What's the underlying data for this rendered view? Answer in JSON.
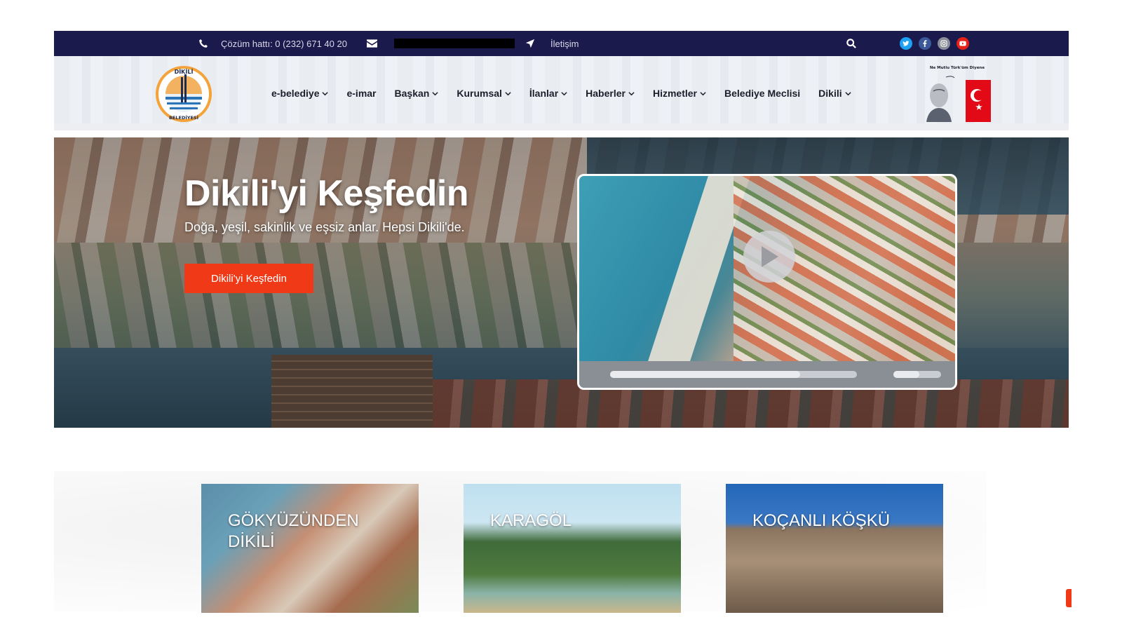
{
  "topbar": {
    "hotline": "Çözüm hattı: 0 (232) 671 40 20",
    "contact": "İletişim",
    "icons": [
      "phone-icon",
      "envelope-icon",
      "location-arrow-icon",
      "search-icon"
    ],
    "socials": [
      {
        "name": "twitter",
        "color": "#1da1f2"
      },
      {
        "name": "facebook",
        "color": "#3b5998"
      },
      {
        "name": "instagram",
        "color": "#8a8f99"
      },
      {
        "name": "youtube",
        "color": "#e62117"
      }
    ]
  },
  "header": {
    "logo_text": "DİKİLİ BELEDİYESİ",
    "nav": [
      {
        "label": "e-belediye",
        "dropdown": true
      },
      {
        "label": "e-imar",
        "dropdown": false
      },
      {
        "label": "Başkan",
        "dropdown": true
      },
      {
        "label": "Kurumsal",
        "dropdown": true
      },
      {
        "label": "İlanlar",
        "dropdown": true
      },
      {
        "label": "Haberler",
        "dropdown": true
      },
      {
        "label": "Hizmetler",
        "dropdown": true
      },
      {
        "label": "Belediye Meclisi",
        "dropdown": false
      },
      {
        "label": "Dikili",
        "dropdown": true
      }
    ],
    "ataturk_caption": "Ne Mutlu Türk'üm Diyene"
  },
  "hero": {
    "title": "Dikili'yi Keşfedin",
    "subtitle": "Doğa, yeşil, sakinlik ve eşsiz anlar. Hepsi Dikili'de.",
    "button": "Dikili'yi Keşfedin",
    "video_progress": 0.77,
    "video_volume": 0.55
  },
  "cards": [
    {
      "title": "GÖKYÜZÜNDEN DİKİLİ"
    },
    {
      "title": "KARAGÖL"
    },
    {
      "title": "KOÇANLI KÖŞKÜ"
    }
  ],
  "colors": {
    "topbar": "#1b1a4d",
    "accent": "#f03a17"
  }
}
